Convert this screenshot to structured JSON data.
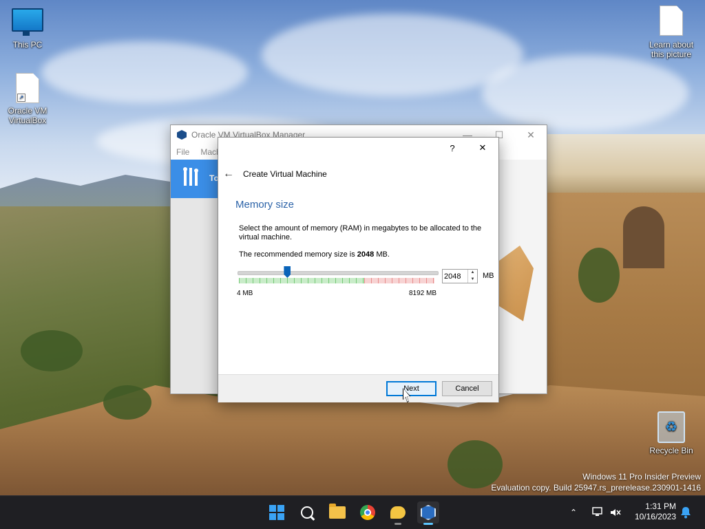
{
  "desktop": {
    "icons": [
      {
        "label": "This PC"
      },
      {
        "label": "Oracle VM VirtualBox"
      },
      {
        "label": "Learn about this picture"
      },
      {
        "label": "Recycle Bin"
      }
    ]
  },
  "manager": {
    "title": "Oracle VM VirtualBox Manager",
    "menu": [
      "File",
      "Mach"
    ],
    "tools_label": "To"
  },
  "dialog": {
    "help_label": "?",
    "close_label": "✕",
    "back_label": "←",
    "title": "Create Virtual Machine",
    "section_title": "Memory size",
    "description": "Select the amount of memory (RAM) in megabytes to be allocated to the virtual machine.",
    "recommended_prefix": "The recommended memory size is ",
    "recommended_value": "2048",
    "recommended_suffix": " MB.",
    "slider": {
      "min_label": "4 MB",
      "max_label": "8192 MB",
      "min": 4,
      "max": 8192,
      "value": 2048,
      "recommended_fraction": 0.64
    },
    "spin_value": "2048",
    "unit": "MB",
    "next_label": "Next",
    "cancel_label": "Cancel"
  },
  "watermark": {
    "line1": "Windows 11 Pro Insider Preview",
    "line2": "Evaluation copy. Build 25947.rs_prerelease.230901-1416"
  },
  "taskbar": {
    "apps": [
      "start-icon",
      "search-icon",
      "file-explorer-icon",
      "chrome-icon",
      "chat-icon",
      "virtualbox-icon"
    ],
    "time": "1:31 PM",
    "date": "10/16/2023"
  },
  "colors": {
    "accent": "#2c63a8",
    "slider_thumb": "#0a64b9",
    "tools_banner": "#3b8ee7",
    "taskbar": "#1f1f23"
  }
}
